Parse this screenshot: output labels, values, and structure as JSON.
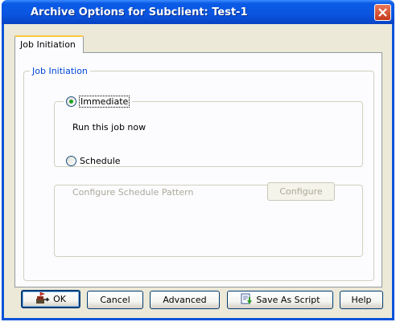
{
  "window": {
    "title": "Archive Options for Subclient: Test-1"
  },
  "tabs": [
    {
      "label": "Job Initiation",
      "selected": true
    }
  ],
  "job_initiation": {
    "group_label": "Job Initiation",
    "immediate": {
      "label": "Immediate",
      "selected": true,
      "description": "Run this job now"
    },
    "schedule": {
      "label": "Schedule",
      "selected": false,
      "pattern_label": "Configure Schedule Pattern",
      "configure_label": "Configure"
    }
  },
  "buttons": {
    "ok": "OK",
    "cancel": "Cancel",
    "advanced": "Advanced",
    "save_as_script": "Save As Script",
    "help": "Help"
  },
  "colors": {
    "titlebar": "#0a55e0",
    "dialog_bg": "#ece9d8",
    "group_label": "#0046d5",
    "tab_accent": "#ffc83c",
    "close_button": "#c53a1a"
  },
  "icons": {
    "close": "close-x-icon",
    "ok": "ok-run-icon",
    "save_as_script": "save-script-icon"
  }
}
